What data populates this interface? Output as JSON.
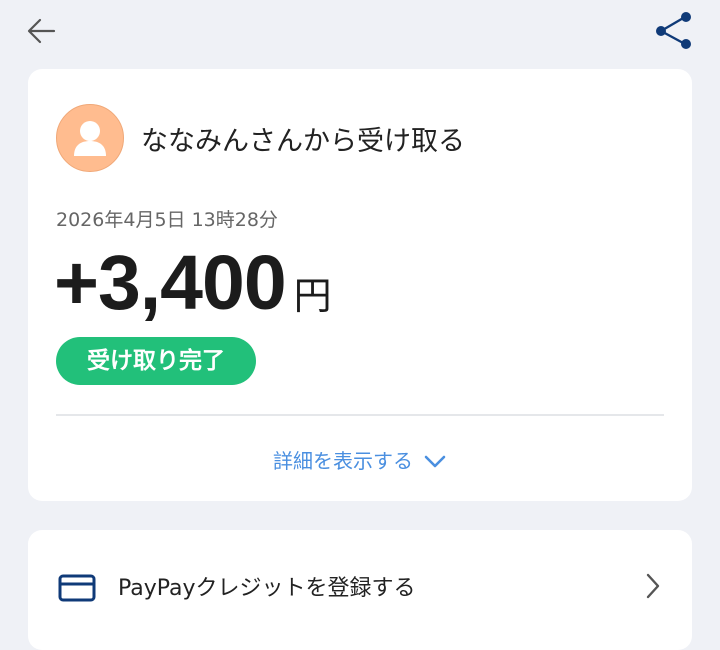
{
  "header": {
    "back_icon": "arrow-left-icon",
    "share_icon": "share-icon",
    "accent_color": "#0f3a78"
  },
  "transaction": {
    "title": "ななみんさんから受け取る",
    "datetime": "2026年4月5日 13時28分",
    "amount": "+3,400",
    "currency": "円",
    "status": "受け取り完了",
    "status_color": "#22c07a",
    "details_label": "詳細を表示する",
    "details_icon": "chevron-down-icon",
    "avatar_icon": "person-icon"
  },
  "promo": {
    "label": "PayPayクレジットを登録する",
    "icon": "credit-card-icon",
    "chevron_icon": "chevron-right-icon"
  }
}
